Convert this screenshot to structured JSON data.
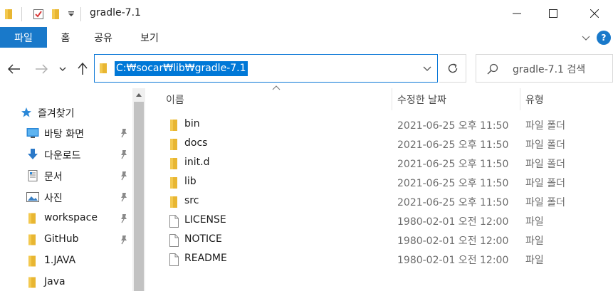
{
  "window": {
    "title": "gradle-7.1",
    "controls": {
      "minimize_icon": "minimize-icon",
      "maximize_icon": "maximize-icon",
      "close_icon": "close-icon"
    }
  },
  "ribbon": {
    "tabs": [
      {
        "label": "파일",
        "active": true
      },
      {
        "label": "홈"
      },
      {
        "label": "공유"
      },
      {
        "label": "보기"
      }
    ],
    "help": "?"
  },
  "address_bar": {
    "path": "C:₩socar₩lib₩gradle-7.1"
  },
  "search": {
    "placeholder": "gradle-7.1 검색"
  },
  "nav_pane": {
    "quick_access": "즐겨찾기",
    "items": [
      {
        "label": "바탕 화면",
        "icon": "desktop-icon",
        "pinned": true
      },
      {
        "label": "다운로드",
        "icon": "download-icon",
        "pinned": true
      },
      {
        "label": "문서",
        "icon": "documents-icon",
        "pinned": true
      },
      {
        "label": "사진",
        "icon": "pictures-icon",
        "pinned": true
      },
      {
        "label": "workspace",
        "icon": "folder-icon",
        "pinned": true
      },
      {
        "label": "GitHub",
        "icon": "folder-icon",
        "pinned": true
      },
      {
        "label": "1.JAVA",
        "icon": "folder-icon",
        "pinned": false
      },
      {
        "label": "Java",
        "icon": "folder-icon",
        "pinned": false
      }
    ]
  },
  "file_list": {
    "columns": {
      "name": "이름",
      "date": "수정한 날짜",
      "type": "유형"
    },
    "rows": [
      {
        "name": "bin",
        "date": "2021-06-25 오후 11:50",
        "type": "파일 폴더",
        "kind": "folder"
      },
      {
        "name": "docs",
        "date": "2021-06-25 오후 11:50",
        "type": "파일 폴더",
        "kind": "folder"
      },
      {
        "name": "init.d",
        "date": "2021-06-25 오후 11:50",
        "type": "파일 폴더",
        "kind": "folder"
      },
      {
        "name": "lib",
        "date": "2021-06-25 오후 11:50",
        "type": "파일 폴더",
        "kind": "folder"
      },
      {
        "name": "src",
        "date": "2021-06-25 오후 11:50",
        "type": "파일 폴더",
        "kind": "folder"
      },
      {
        "name": "LICENSE",
        "date": "1980-02-01 오전 12:00",
        "type": "파일",
        "kind": "file"
      },
      {
        "name": "NOTICE",
        "date": "1980-02-01 오전 12:00",
        "type": "파일",
        "kind": "file"
      },
      {
        "name": "README",
        "date": "1980-02-01 오전 12:00",
        "type": "파일",
        "kind": "file"
      }
    ]
  },
  "colors": {
    "accent": "#0078d7",
    "file_tab": "#1979ca",
    "folder": "#e8b632"
  }
}
